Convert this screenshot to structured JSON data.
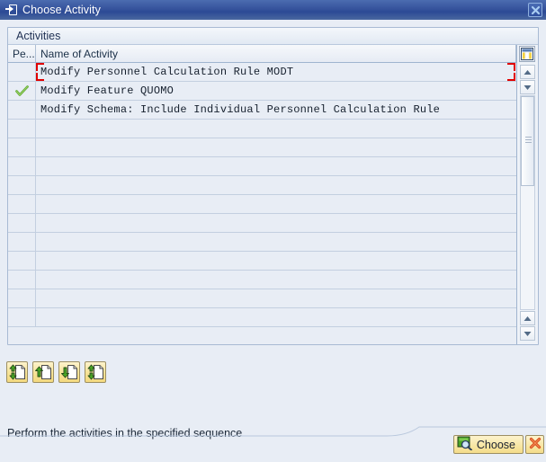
{
  "window": {
    "title": "Choose Activity",
    "title_icon": "dialog-export-icon",
    "close_icon": "close-icon",
    "titlebar_color": "#36539c"
  },
  "group": {
    "label": "Activities"
  },
  "table": {
    "columns": [
      {
        "key": "pe",
        "label": "Pe...",
        "name": "column-header-performed"
      },
      {
        "key": "name",
        "label": "Name of Activity",
        "name": "column-header-name-of-activity"
      }
    ],
    "config_icon": "table-settings-icon",
    "rows": [
      {
        "status": "",
        "name": "Modify Personnel Calculation Rule MODT",
        "selected": true
      },
      {
        "status": "done",
        "name": "Modify Feature QUOMO",
        "selected": false
      },
      {
        "status": "",
        "name": "Modify Schema: Include Individual Personnel Calculation Rule",
        "selected": false
      }
    ],
    "empty_row_count": 11,
    "selection_color": "#e00000",
    "done_icon": "green-check-icon",
    "done_color": "#5aa72a"
  },
  "scrollbar": {
    "up_icon": "scroll-up-icon",
    "down_icon": "scroll-down-icon",
    "thumb_grip_icon": "scroll-thumb-grip-icon"
  },
  "toolbar": {
    "buttons": [
      {
        "name": "expand-collapse-all-button",
        "icon": "document-up-down-arrow-icon"
      },
      {
        "name": "collapse-button",
        "icon": "document-up-arrow-icon"
      },
      {
        "name": "expand-button",
        "icon": "document-down-arrow-icon"
      },
      {
        "name": "expand-collapse-node-button",
        "icon": "document-up-down-arrow-icon"
      }
    ]
  },
  "status": {
    "text": "Perform the activities in the specified sequence"
  },
  "footer": {
    "choose_label": "Choose",
    "choose_icon": "choose-magnifier-icon",
    "cancel_icon": "red-x-icon",
    "cancel_color": "#d94c1e"
  }
}
